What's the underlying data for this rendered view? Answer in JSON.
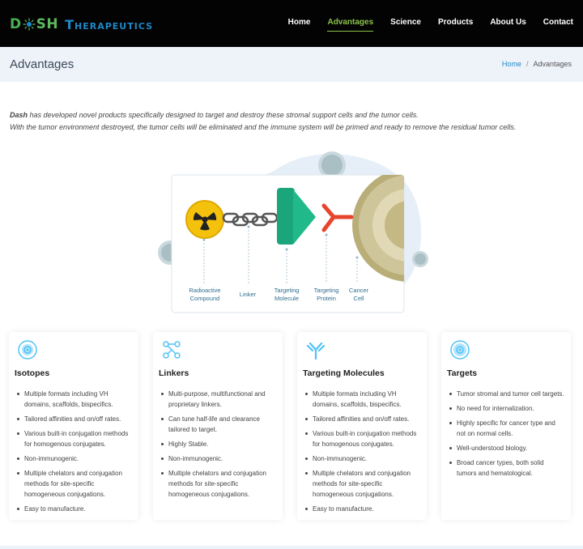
{
  "header": {
    "logo_dash_letters": [
      "D",
      "SH"
    ],
    "logo_therapeutics": "Therapeutics",
    "nav": [
      {
        "label": "Home",
        "active": false
      },
      {
        "label": "Advantages",
        "active": true
      },
      {
        "label": "Science",
        "active": false
      },
      {
        "label": "Products",
        "active": false
      },
      {
        "label": "About Us",
        "active": false
      },
      {
        "label": "Contact",
        "active": false
      }
    ]
  },
  "titlebar": {
    "title": "Advantages",
    "breadcrumb": {
      "home": "Home",
      "separator": "/",
      "current": "Advantages"
    }
  },
  "intro": {
    "brand": "Dash",
    "line1_rest": " has developed novel products specifically designed to target and destroy these stromal support cells and the tumor cells.",
    "line2": "With the tumor environment destroyed, the tumor cells will be eliminated and the immune system will be primed and ready to remove the residual tumor cells."
  },
  "illustration": {
    "labels": {
      "radioactive_compound": [
        "Radioactive",
        "Compound"
      ],
      "linker": [
        "Linker"
      ],
      "targeting_molecule": [
        "Targeting",
        "Molecule"
      ],
      "targeting_protein": [
        "Targeting",
        "Protein"
      ],
      "cancer_cell": [
        "Cancer",
        "Cell"
      ]
    }
  },
  "cards": [
    {
      "icon": "isotope-target-icon",
      "title": "Isotopes",
      "items": [
        "Multiple formats including VH domains, scaffolds, bispecifics.",
        "Tailored affinities and on/off rates.",
        "Various built-in conjugation methods for homogenous conjugates.",
        "Non-immunogenic.",
        "Multiple chelators and conjugation methods for site-specific homogeneous conjugations.",
        "Easy to manufacture."
      ]
    },
    {
      "icon": "linker-nodes-icon",
      "title": "Linkers",
      "items": [
        "Multi-purpose, multifunctional and proprietary linkers.",
        "Can tune half-life and clearance tailored to target.",
        "Highly Stable.",
        "Non-immunogenic.",
        "Multiple chelators and conjugation methods for site-specific homogeneous conjugations."
      ]
    },
    {
      "icon": "antibody-icon",
      "title": "Targeting Molecules",
      "items": [
        "Multiple formats including VH domains, scaffolds, bispecifics.",
        "Tailored affinities and on/off rates.",
        "Various built-in conjugation methods for homogenous conjugates.",
        "Non-immunogenic.",
        "Multiple chelators and conjugation methods for site-specific homogeneous conjugations.",
        "Easy to manufacture."
      ]
    },
    {
      "icon": "target-cell-icon",
      "title": "Targets",
      "items": [
        "Tumor stromal and tumor cell targets.",
        "No need for internalization.",
        "Highly specific for cancer type and not on normal cells.",
        "Well-understood biology.",
        "Broad cancer types, both solid tumors and hematological."
      ]
    }
  ],
  "colors": {
    "header_bg": "#030303",
    "nav_active": "#8bc34a",
    "brand_blue": "#1e88c8",
    "titlebar_bg": "#eef2f9",
    "icon_blue": "#4fc3f7"
  }
}
